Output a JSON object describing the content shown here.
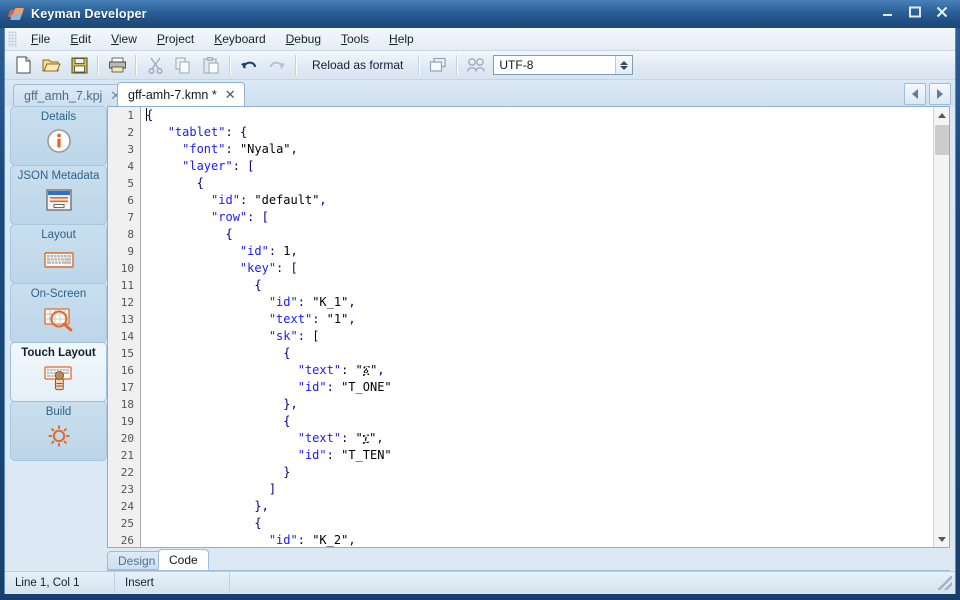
{
  "window": {
    "title": "Keyman Developer",
    "icon": "keyman-logo-icon",
    "minimize_label": "–",
    "maximize_label": "❐",
    "close_label": "✕"
  },
  "menubar": {
    "items": [
      {
        "label": "File",
        "accel": "F"
      },
      {
        "label": "Edit",
        "accel": "E"
      },
      {
        "label": "View",
        "accel": "V"
      },
      {
        "label": "Project",
        "accel": "P"
      },
      {
        "label": "Keyboard",
        "accel": "K"
      },
      {
        "label": "Debug",
        "accel": "D"
      },
      {
        "label": "Tools",
        "accel": "T"
      },
      {
        "label": "Help",
        "accel": "H"
      }
    ]
  },
  "toolbar": {
    "buttons": [
      {
        "name": "new-icon",
        "label": "New"
      },
      {
        "name": "open-icon",
        "label": "Open"
      },
      {
        "name": "save-icon",
        "label": "Save"
      },
      {
        "name": "print-icon",
        "label": "Print"
      },
      {
        "name": "cut-icon",
        "label": "Cut"
      },
      {
        "name": "copy-icon",
        "label": "Copy"
      },
      {
        "name": "paste-icon",
        "label": "Paste"
      },
      {
        "name": "undo-icon",
        "label": "Undo"
      },
      {
        "name": "redo-icon",
        "label": "Redo"
      }
    ],
    "reload_label": "Reload as format",
    "window-icon-label": "Windows",
    "users-icon-label": "Users",
    "encoding": {
      "value": "UTF-8",
      "placeholder": "Encoding"
    }
  },
  "tabs": [
    {
      "label": "gff_amh_7.kpj",
      "modified": false,
      "active": false,
      "close": "✕"
    },
    {
      "label": "gff-amh-7.kmn *",
      "modified": true,
      "active": true,
      "close": "✕"
    }
  ],
  "tab_nav": {
    "prev_label": "Previous tab",
    "next_label": "Next tab"
  },
  "sidebar": {
    "items": [
      {
        "label": "Details",
        "icon": "info-circle-icon",
        "selected": false
      },
      {
        "label": "JSON Metadata",
        "icon": "metadata-card-icon",
        "selected": false
      },
      {
        "label": "Layout",
        "icon": "keyboard-icon",
        "selected": false
      },
      {
        "label": "On-Screen",
        "icon": "osk-magnifier-icon",
        "selected": false
      },
      {
        "label": "Touch Layout",
        "icon": "touch-keyboard-icon",
        "selected": true
      },
      {
        "label": "Build",
        "icon": "gear-icon",
        "selected": false
      }
    ]
  },
  "editor": {
    "first_visible_line": 1,
    "line_numbers": [
      1,
      2,
      3,
      4,
      5,
      6,
      7,
      8,
      9,
      10,
      11,
      12,
      13,
      14,
      15,
      16,
      17,
      18,
      19,
      20,
      21,
      22,
      23,
      24,
      25,
      26
    ],
    "lines": [
      "{",
      "   \"tablet\": {",
      "     \"font\": \"Nyala\",",
      "     \"layer\": [",
      "       {",
      "         \"id\": \"default\",",
      "         \"row\": [",
      "           {",
      "             \"id\": 1,",
      "             \"key\": [",
      "               {",
      "                 \"id\": \"K_1\",",
      "                 \"text\": \"1\",",
      "                 \"sk\": [",
      "                   {",
      "                     \"text\": \"፩\",",
      "                     \"id\": \"T_ONE\"",
      "                   },",
      "                   {",
      "                     \"text\": \"፲\",",
      "                     \"id\": \"T_TEN\"",
      "                   }",
      "                 ]",
      "               },",
      "               {",
      "                 \"id\": \"K_2\","
    ],
    "scroll": {
      "vertical_up": "▲",
      "vertical_down": "▼"
    }
  },
  "view_tabs": [
    {
      "label": "Design",
      "active": false
    },
    {
      "label": "Code",
      "active": true
    }
  ],
  "statusbar": {
    "position": "Line 1, Col 1",
    "mode": "Insert",
    "extra": ""
  },
  "colors": {
    "titlebar_blue": "#2f669d",
    "frame_blue": "#17406f",
    "accent_orange": "#e06a28",
    "json_blue": "#1a1aff",
    "panel_blue": "#c9dfee",
    "selected_panel": "#f2f8fc"
  }
}
